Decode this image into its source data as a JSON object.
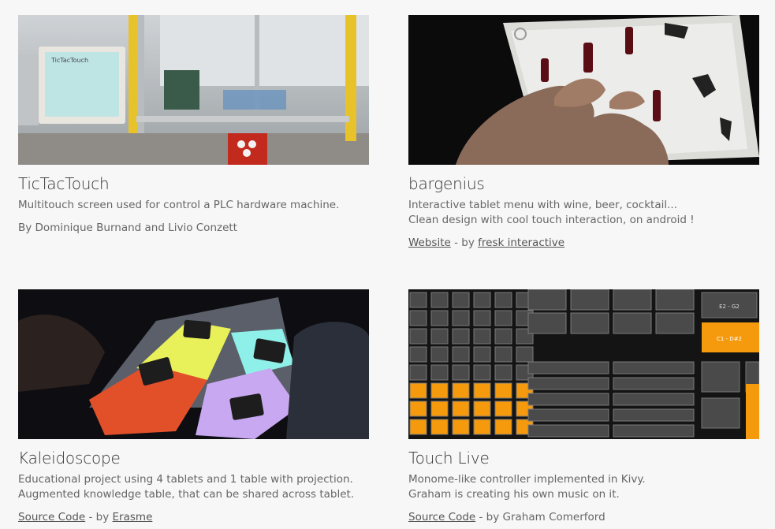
{
  "projects": [
    {
      "title": "TicTacTouch",
      "desc1": "Multitouch screen used for control a PLC hardware machine.",
      "desc2": "",
      "byline": "By Dominique Burnand and Livio Conzett",
      "screen_text": "TicTacTouch"
    },
    {
      "title": "bargenius",
      "desc1": "Interactive tablet menu with wine, beer, cocktail...",
      "desc2": "Clean design with cool touch interaction, on android !",
      "link1": "Website",
      "sep": " - by ",
      "link2": "fresk interactive"
    },
    {
      "title": "Kaleidoscope",
      "desc1": "Educational project using 4 tablets and 1 table with projection.",
      "desc2": "Augmented knowledge table, that can be shared across tablet.",
      "link1": "Source Code",
      "sep": " - by ",
      "link2": "Erasme"
    },
    {
      "title": "Touch Live",
      "desc1": "Monome-like controller implemented in Kivy.",
      "desc2": "Graham is creating his own music on it.",
      "link1": "Source Code",
      "sep": " - by Graham Comerford",
      "pad_labels": [
        "E2 - G2",
        "C1 - D#2"
      ]
    }
  ]
}
